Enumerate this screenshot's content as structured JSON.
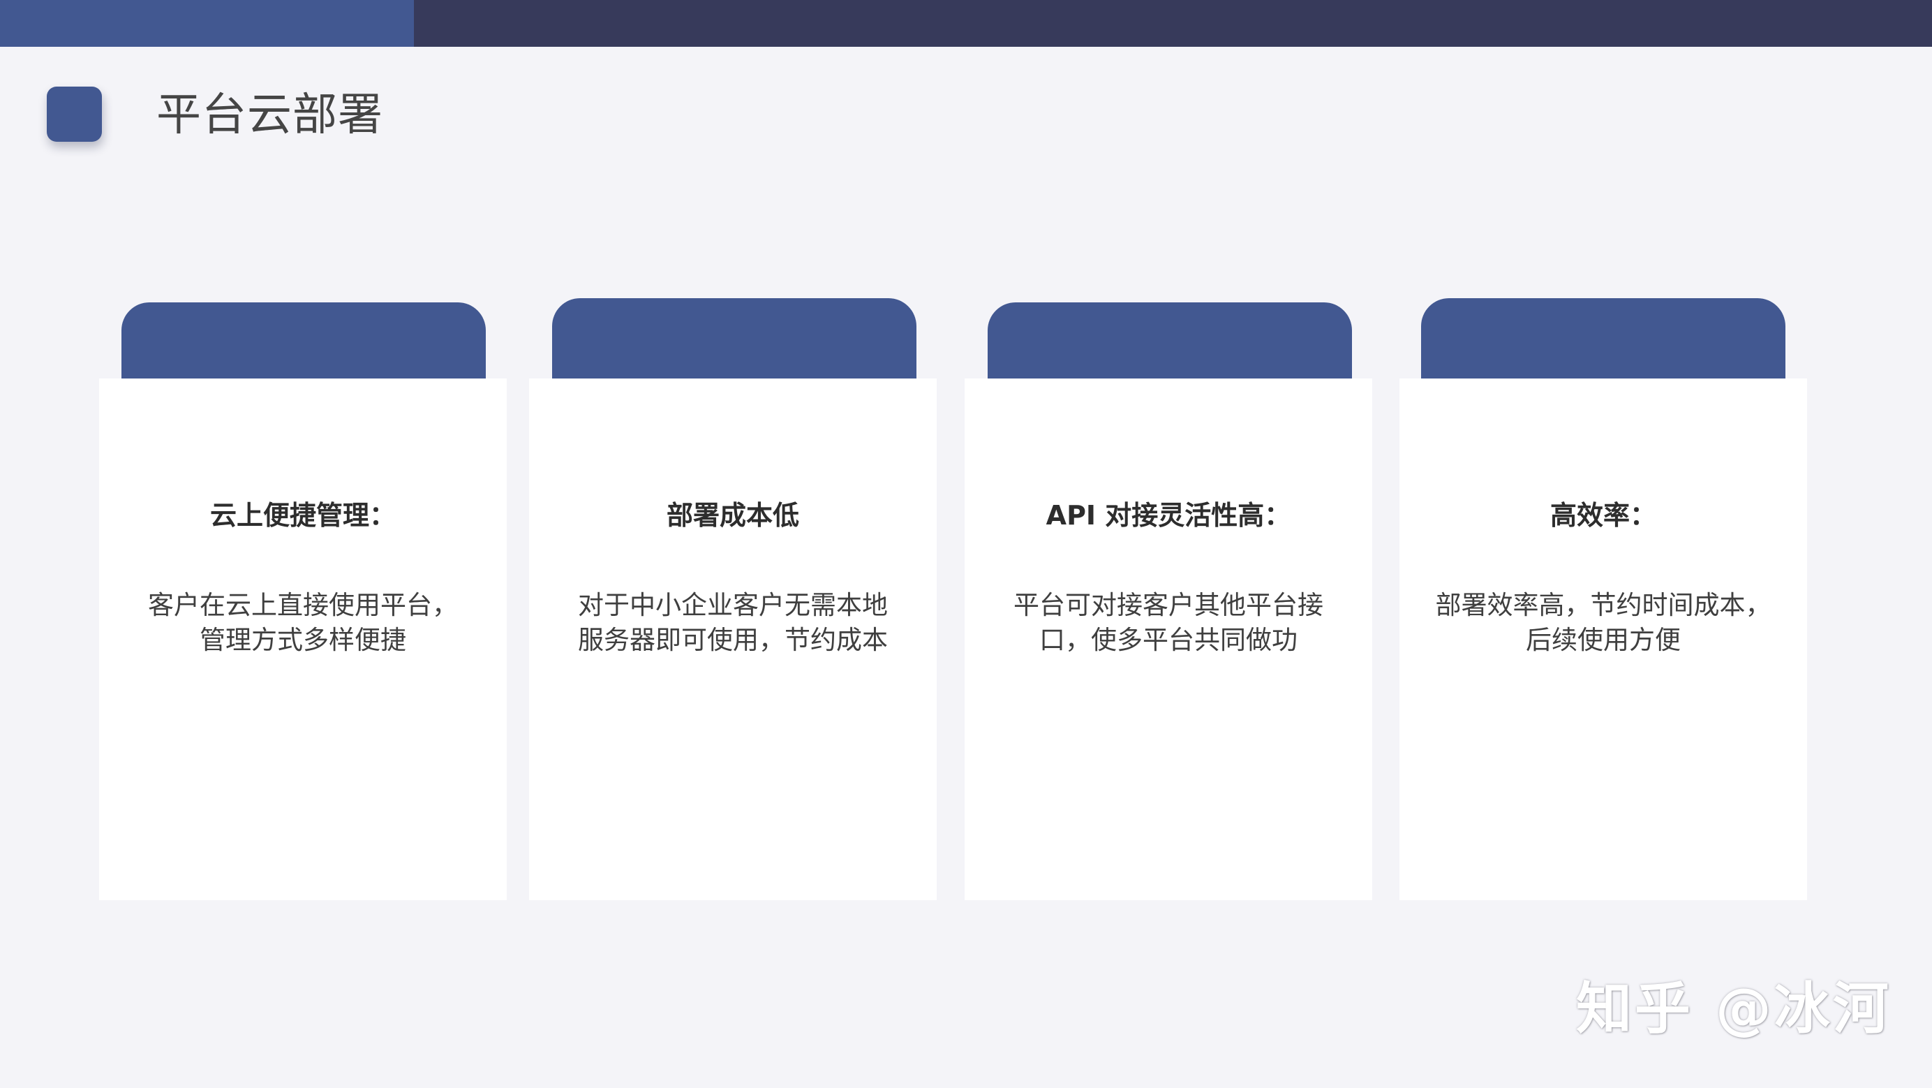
{
  "page": {
    "title": "平台云部署",
    "colors": {
      "accent": "#425891",
      "header_dark": "#373a5b",
      "background": "#f4f4f8",
      "card": "#ffffff"
    }
  },
  "cards": [
    {
      "heading": "云上便捷管理：",
      "body_lines": [
        "客户在云上直接使用平台，",
        "管理方式多样便捷"
      ]
    },
    {
      "heading": "部署成本低",
      "body_lines": [
        "对于中小企业客户无需本地",
        "服务器即可使用，节约成本"
      ]
    },
    {
      "heading": "API 对接灵活性高：",
      "body_lines": [
        "平台可对接客户其他平台接",
        "口，使多平台共同做功"
      ]
    },
    {
      "heading": "高效率：",
      "body_lines": [
        "部署效率高，节约时间成本，",
        "后续使用方便"
      ]
    }
  ],
  "watermark": "知乎 @冰河"
}
